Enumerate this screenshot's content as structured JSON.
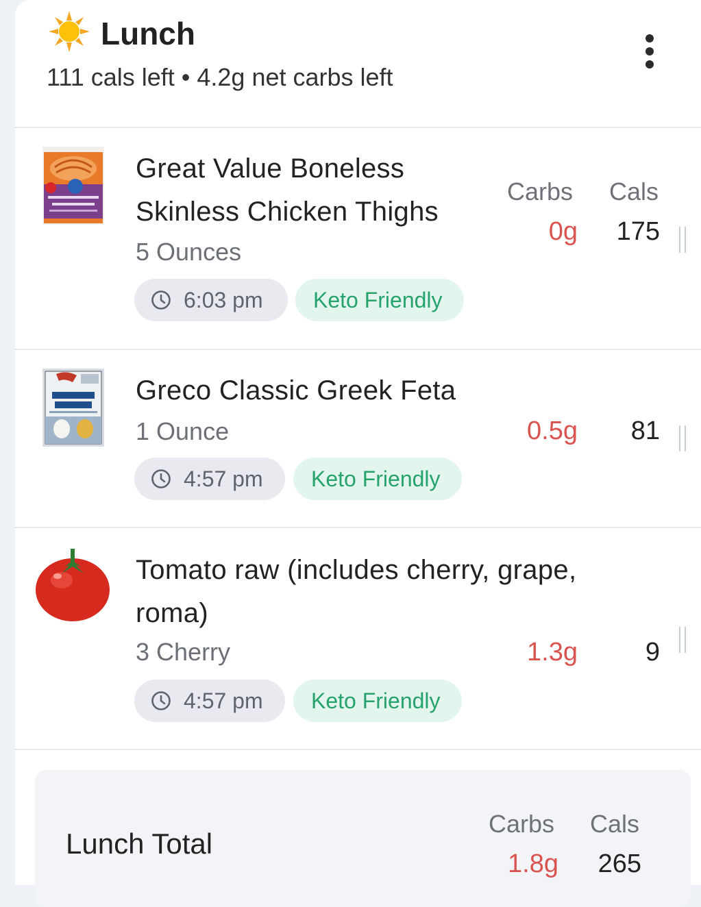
{
  "meal": {
    "title": "Lunch",
    "summary": "111 cals left • 4.2g net carbs left"
  },
  "columns": {
    "carbs": "Carbs",
    "cals": "Cals"
  },
  "items": [
    {
      "name": "Great Value Boneless Skinless Chicken Thighs",
      "serving": "5 Ounces",
      "time": "6:03 pm",
      "tag": "Keto Friendly",
      "carbs": "0g",
      "cals": "175",
      "thumb_text": [
        "Great Value",
        "Boneless Skinless Chicken Thighs"
      ]
    },
    {
      "name": "Greco Classic Greek Feta",
      "serving": "1 Ounce",
      "time": "4:57 pm",
      "tag": "Keto Friendly",
      "carbs": "0.5g",
      "cals": "81",
      "thumb_text": [
        "Greco",
        "GREEK FETA"
      ]
    },
    {
      "name": "Tomato raw (includes cherry, grape, roma)",
      "serving": "3 Cherry",
      "time": "4:57 pm",
      "tag": "Keto Friendly",
      "carbs": "1.3g",
      "cals": "9"
    }
  ],
  "total": {
    "label": "Lunch Total",
    "carbs": "1.8g",
    "cals": "265"
  },
  "icons": [
    "sun-icon",
    "more-options-icon",
    "clock-icon",
    "drag-handle-icon"
  ],
  "colors": {
    "carbs": "#d9534f",
    "keto_text": "#26a36b",
    "keto_bg": "#e3f6ee",
    "time_bg": "#e8eaef"
  }
}
